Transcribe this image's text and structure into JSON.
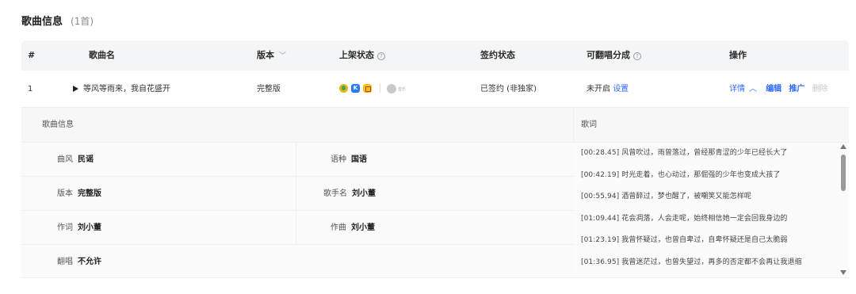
{
  "section": {
    "title": "歌曲信息",
    "count": "(1首)"
  },
  "table": {
    "headers": {
      "index": "#",
      "song_name": "歌曲名",
      "version": "版本",
      "listing_status": "上架状态",
      "sign_status": "签约状态",
      "cover_share": "可翻唱分成",
      "actions": "操作"
    },
    "rows": [
      {
        "index": "1",
        "song_name": "等风等雨来，我自花盛开",
        "version": "完整版",
        "platform_off_label": "音乐",
        "sign_status": "已签约 (非独家)",
        "cover_share_status": "未开启",
        "cover_share_link": "设置",
        "actions": {
          "detail": "详情",
          "edit": "编辑",
          "promote": "推广",
          "delete": "删除"
        }
      }
    ]
  },
  "detail": {
    "info_title": "歌曲信息",
    "fields": [
      {
        "left": {
          "label": "曲风",
          "value": "民谣"
        },
        "right": {
          "label": "语种",
          "value": "国语"
        }
      },
      {
        "left": {
          "label": "版本",
          "value": "完整版"
        },
        "right": {
          "label": "歌手名",
          "value": "刘小董"
        }
      },
      {
        "left": {
          "label": "作词",
          "value": "刘小董"
        },
        "right": {
          "label": "作曲",
          "value": "刘小董"
        }
      },
      {
        "left": {
          "label": "翻唱",
          "value": "不允许"
        }
      }
    ],
    "lyrics_title": "歌词",
    "lyrics": [
      "[00:28.45] 风曾吹过，雨曾落过，曾经那青涩的少年已经长大了",
      "[00:42.19] 时光走着，也心动过，那倔强的少年也变成大孩了",
      "[00:55.94] 酒曾醉过，梦也醒了，被嘲笑又能怎样呢",
      "[01:09.44] 花会凋落，人会走呢，始终相信她一定会回我身边的",
      "[01:23.19] 我曾怀疑过，也曾自卑过，自卑怀疑还是自己太脆弱",
      "[01:36.95] 我曾迷茫过，也曾失望过，再多的否定都不会再让我退缩"
    ]
  },
  "colors": {
    "link": "#2f6bff",
    "header_bg": "#f4f5f7"
  }
}
